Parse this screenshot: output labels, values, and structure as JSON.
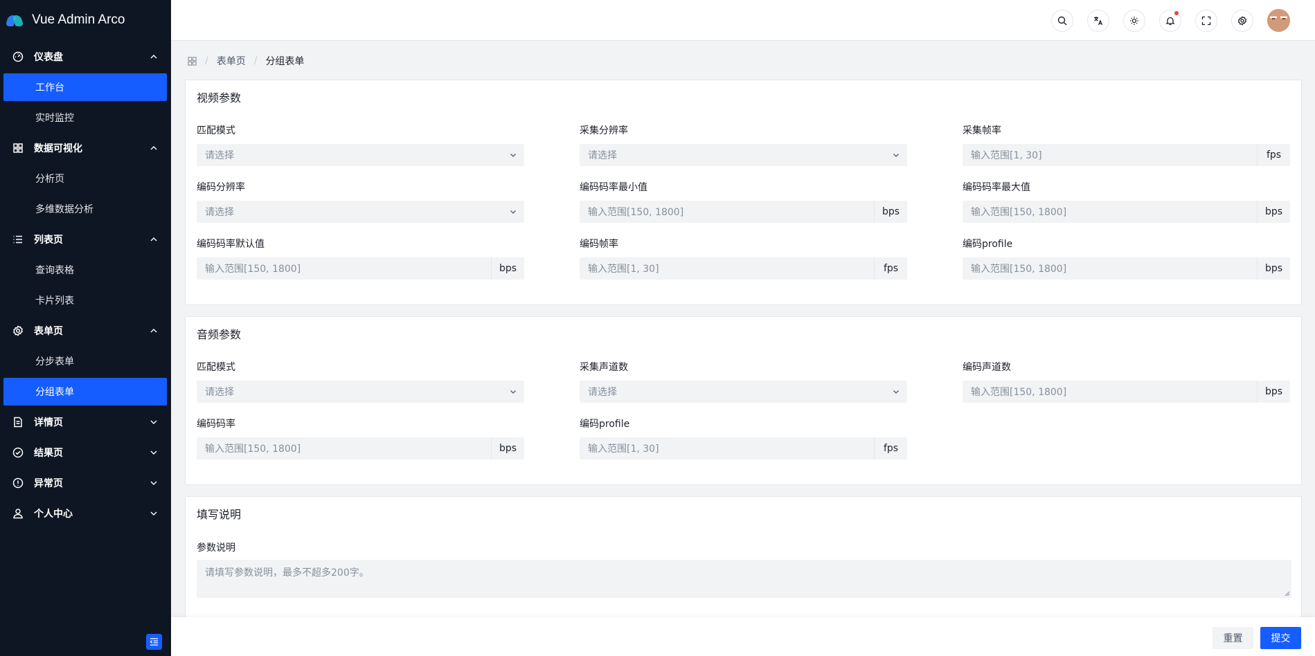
{
  "app": {
    "title": "Vue Admin Arco"
  },
  "sidebar": {
    "groups": [
      {
        "label": "仪表盘",
        "icon": "dashboard-icon",
        "expanded": true,
        "items": [
          "工作台",
          "实时监控"
        ]
      },
      {
        "label": "数据可视化",
        "icon": "grid-icon",
        "expanded": true,
        "items": [
          "分析页",
          "多维数据分析"
        ]
      },
      {
        "label": "列表页",
        "icon": "list-icon",
        "expanded": true,
        "items": [
          "查询表格",
          "卡片列表"
        ]
      },
      {
        "label": "表单页",
        "icon": "settings-icon",
        "expanded": true,
        "items": [
          "分步表单",
          "分组表单"
        ]
      },
      {
        "label": "详情页",
        "icon": "file-icon",
        "expanded": false,
        "items": []
      },
      {
        "label": "结果页",
        "icon": "check-circle-icon",
        "expanded": false,
        "items": []
      },
      {
        "label": "异常页",
        "icon": "exclamation-circle-icon",
        "expanded": false,
        "items": []
      },
      {
        "label": "个人中心",
        "icon": "user-icon",
        "expanded": false,
        "items": []
      }
    ],
    "active_items": [
      "工作台",
      "分组表单"
    ],
    "accent_color": "#165dff",
    "background_color": "#0f1623"
  },
  "topnav": {
    "icons": [
      "search-icon",
      "translate-icon",
      "theme-icon",
      "bell-icon",
      "fullscreen-icon",
      "settings-icon"
    ],
    "notification_dot": true,
    "avatar": "avatar"
  },
  "breadcrumb": {
    "items": [
      "表单页",
      "分组表单"
    ]
  },
  "video": {
    "title": "视频参数",
    "fields": [
      {
        "label": "匹配模式",
        "placeholder": "请选择",
        "type": "select"
      },
      {
        "label": "采集分辨率",
        "placeholder": "请选择",
        "type": "select"
      },
      {
        "label": "采集帧率",
        "placeholder": "输入范围[1, 30]",
        "type": "input",
        "suffix": "fps"
      },
      {
        "label": "编码分辨率",
        "placeholder": "请选择",
        "type": "select"
      },
      {
        "label": "编码码率最小值",
        "placeholder": "输入范围[150, 1800]",
        "type": "input",
        "suffix": "bps"
      },
      {
        "label": "编码码率最大值",
        "placeholder": "输入范围[150, 1800]",
        "type": "input",
        "suffix": "bps"
      },
      {
        "label": "编码码率默认值",
        "placeholder": "输入范围[150, 1800]",
        "type": "input",
        "suffix": "bps"
      },
      {
        "label": "编码帧率",
        "placeholder": "输入范围[1, 30]",
        "type": "input",
        "suffix": "fps"
      },
      {
        "label": "编码profile",
        "placeholder": "输入范围[150, 1800]",
        "type": "input",
        "suffix": "bps"
      }
    ]
  },
  "audio": {
    "title": "音频参数",
    "fields": [
      {
        "label": "匹配模式",
        "placeholder": "请选择",
        "type": "select"
      },
      {
        "label": "采集声道数",
        "placeholder": "请选择",
        "type": "select"
      },
      {
        "label": "编码声道数",
        "placeholder": "输入范围[150, 1800]",
        "type": "input",
        "suffix": "bps"
      },
      {
        "label": "编码码率",
        "placeholder": "输入范围[150, 1800]",
        "type": "input",
        "suffix": "bps"
      },
      {
        "label": "编码profile",
        "placeholder": "输入范围[1, 30]",
        "type": "input",
        "suffix": "fps"
      }
    ]
  },
  "notes": {
    "title": "填写说明",
    "label": "参数说明",
    "placeholder": "请填写参数说明，最多不超多200字。"
  },
  "footer": {
    "reset_label": "重置",
    "submit_label": "提交"
  }
}
